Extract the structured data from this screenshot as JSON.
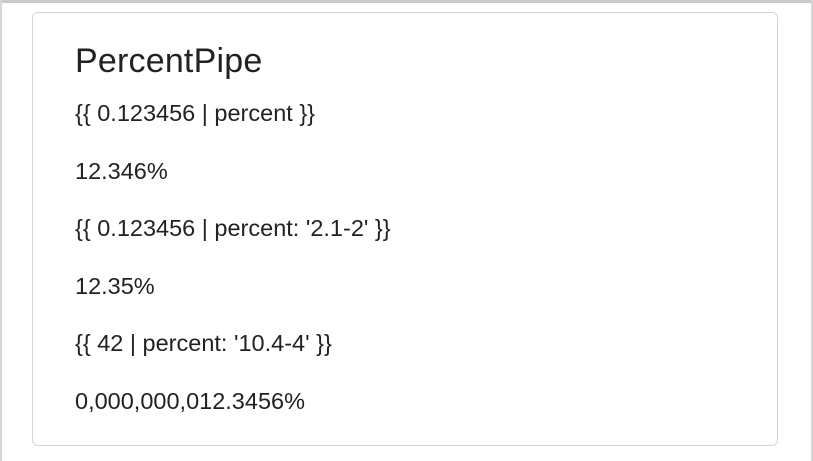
{
  "card": {
    "title": "PercentPipe",
    "lines": [
      "{{ 0.123456 | percent }}",
      "12.346%",
      "{{ 0.123456 | percent: '2.1-2' }}",
      "12.35%",
      "{{ 42 | percent: '10.4-4' }}",
      "0,000,000,012.3456%"
    ]
  }
}
